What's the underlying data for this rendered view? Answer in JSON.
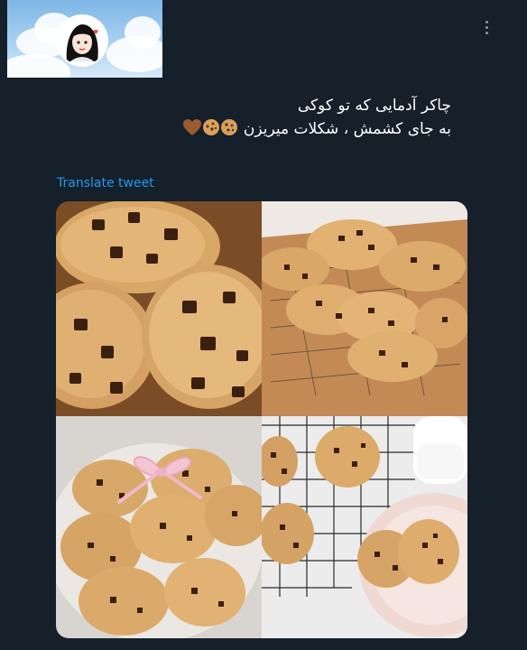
{
  "tweet": {
    "text_line1": "چاکر آدمایی که تو کوکی",
    "text_line2": "به جای کشمش ، شکلات میریزن",
    "translate_label": "Translate tweet"
  },
  "icons": {
    "more": "vertical-ellipsis-icon",
    "emoji1": "cookie-emoji",
    "emoji2": "brown-heart-emoji"
  },
  "colors": {
    "background": "#15202b",
    "link": "#1d9bf0",
    "muted": "#8b98a5"
  },
  "media": {
    "photos": [
      "chocolate-chunk-cookies-closeup",
      "cookies-on-cooling-rack",
      "cookies-with-pink-ribbon-on-plate",
      "cookies-with-milk-on-rack-and-plate"
    ]
  }
}
